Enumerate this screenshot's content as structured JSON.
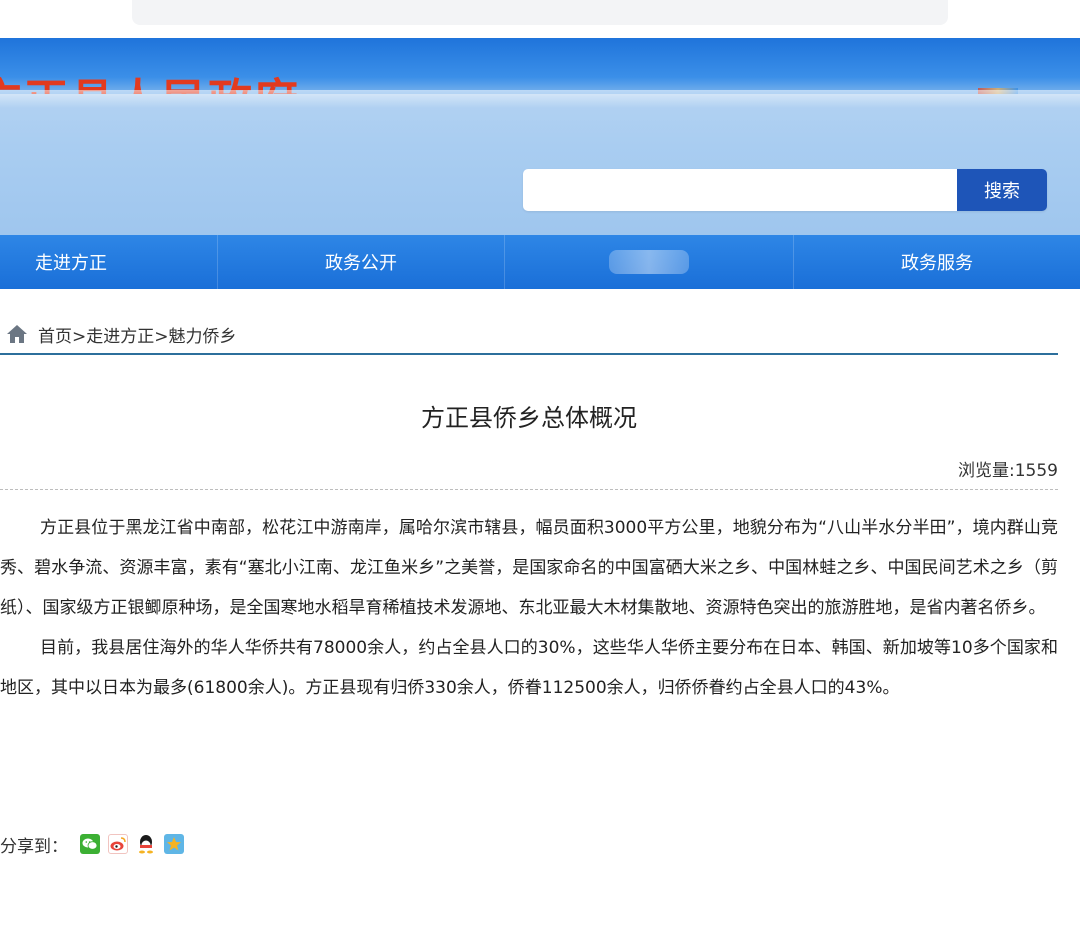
{
  "site": {
    "banner_title": "方正县人民政府"
  },
  "search": {
    "placeholder": "",
    "button_label": "搜索"
  },
  "nav": {
    "items": [
      {
        "label": "走进方正"
      },
      {
        "label": "政务公开"
      },
      {
        "label": ""
      },
      {
        "label": "政务服务"
      }
    ]
  },
  "breadcrumb": {
    "text": "首页>走进方正>魅力侨乡"
  },
  "article": {
    "title": "方正县侨乡总体概况",
    "views": "浏览量:1559",
    "paragraphs": [
      "方正县位于黑龙江省中南部，松花江中游南岸，属哈尔滨市辖县，幅员面积3000平方公里，地貌分布为“八山半水分半田”，境内群山竞秀、碧水争流、资源丰富，素有“塞北小江南、龙江鱼米乡”之美誉，是国家命名的中国富硒大米之乡、中国林蛙之乡、中国民间艺术之乡（剪纸）、国家级方正银鲫原种场，是全国寒地水稻旱育稀植技术发源地、东北亚最大木材集散地、资源特色突出的旅游胜地，是省内著名侨乡。",
      "目前，我县居住海外的华人华侨共有78000余人，约占全县人口的30%，这些华人华侨主要分布在日本、韩国、新加坡等10多个国家和地区，其中以日本为最多(61800余人)。方正县现有归侨330余人，侨眷112500余人，归侨侨眷约占全县人口的43%。"
    ]
  },
  "share": {
    "label": "分享到：",
    "icons": [
      {
        "name": "wechat-icon",
        "color": "#3cb034"
      },
      {
        "name": "weibo-icon",
        "color": "#e8443a"
      },
      {
        "name": "qq-icon",
        "color": "#1b1b1b"
      },
      {
        "name": "qzone-icon",
        "color": "#f5b323"
      }
    ]
  },
  "colors": {
    "nav_bg": "#1a6fd8",
    "search_button": "#1e55b8",
    "banner_title": "#e23a1f",
    "breadcrumb_line": "#2c6f9c"
  }
}
